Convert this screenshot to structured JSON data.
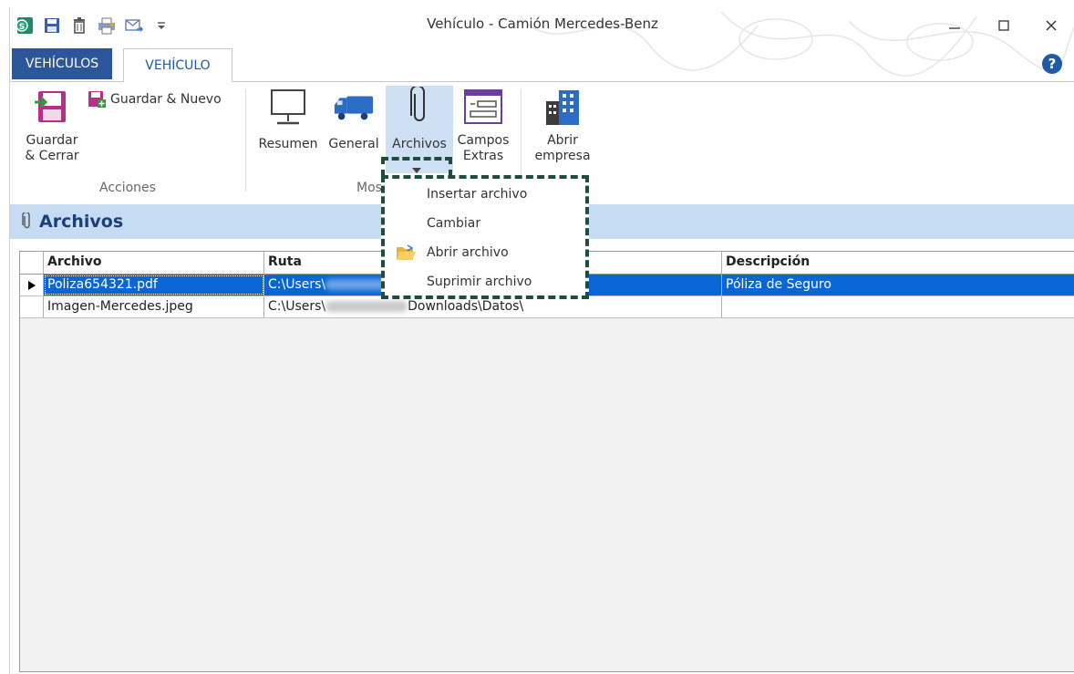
{
  "window": {
    "title": "Vehículo - Camión Mercedes-Benz"
  },
  "tabs": {
    "file": "VEHÍCULOS",
    "active": "VEHÍCULO"
  },
  "ribbon": {
    "save_close": [
      "Guardar",
      "& Cerrar"
    ],
    "save_new": "Guardar & Nuevo",
    "group_actions": "Acciones",
    "summary": "Resumen",
    "general": "General",
    "files": "Archivos",
    "extra_fields": [
      "Campos",
      "Extras"
    ],
    "open_company": [
      "Abrir",
      "empresa"
    ],
    "group_show": "Mos"
  },
  "section": {
    "title": "Archivos"
  },
  "grid": {
    "columns": [
      "Archivo",
      "Ruta",
      "Descripción"
    ],
    "rows": [
      {
        "file": "Poliza654321.pdf",
        "path_prefix": "C:\\Users\\",
        "path_suffix": "",
        "description": "Póliza de Seguro"
      },
      {
        "file": "Imagen-Mercedes.jpeg",
        "path_prefix": "C:\\Users\\",
        "path_suffix": "Downloads\\Datos\\",
        "description": ""
      }
    ]
  },
  "menu": {
    "items": [
      "Insertar archivo",
      "Cambiar",
      "Abrir archivo",
      "Suprimir archivo"
    ]
  },
  "colors": {
    "file_tab": "#2b579a",
    "section_bar": "#c5dcf2",
    "selection": "#0a66d4",
    "menu_border": "#1d4d3c"
  }
}
